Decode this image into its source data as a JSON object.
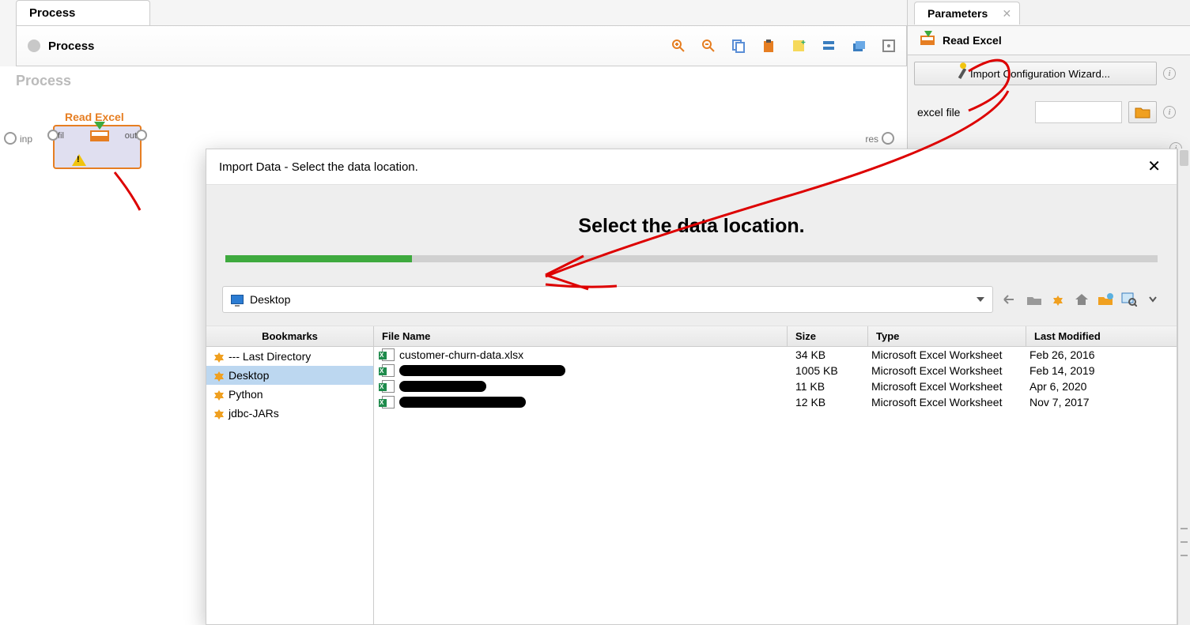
{
  "process_tab": "Process",
  "process_header": "Process",
  "canvas_title": "Process",
  "operator": {
    "title": "Read Excel",
    "port_in": "fil",
    "port_out": "out",
    "canvas_port_in": "inp",
    "canvas_port_out": "res"
  },
  "parameters": {
    "tab": "Parameters",
    "title": "Read Excel",
    "wizard_button": "Import Configuration Wizard...",
    "excel_file_label": "excel file",
    "excel_file_value": ""
  },
  "dialog": {
    "title": "Import Data - Select the data location.",
    "heading": "Select the data location.",
    "path": "Desktop",
    "bookmarks_header": "Bookmarks",
    "bookmarks": [
      {
        "label": "--- Last Directory",
        "selected": false
      },
      {
        "label": "Desktop",
        "selected": true
      },
      {
        "label": "Python",
        "selected": false
      },
      {
        "label": "jdbc-JARs",
        "selected": false
      }
    ],
    "columns": {
      "name": "File Name",
      "size": "Size",
      "type": "Type",
      "modified": "Last Modified"
    },
    "files": [
      {
        "name": "customer-churn-data.xlsx",
        "redacted": false,
        "redact_w": 0,
        "size": "34 KB",
        "type": "Microsoft Excel Worksheet",
        "modified": "Feb 26, 2016"
      },
      {
        "name": "",
        "redacted": true,
        "redact_w": 210,
        "size": "1005 KB",
        "type": "Microsoft Excel Worksheet",
        "modified": "Feb 14, 2019"
      },
      {
        "name": "",
        "redacted": true,
        "redact_w": 110,
        "size": "11 KB",
        "type": "Microsoft Excel Worksheet",
        "modified": "Apr 6, 2020"
      },
      {
        "name": "",
        "redacted": true,
        "redact_w": 160,
        "size": "12 KB",
        "type": "Microsoft Excel Worksheet",
        "modified": "Nov 7, 2017"
      }
    ]
  }
}
